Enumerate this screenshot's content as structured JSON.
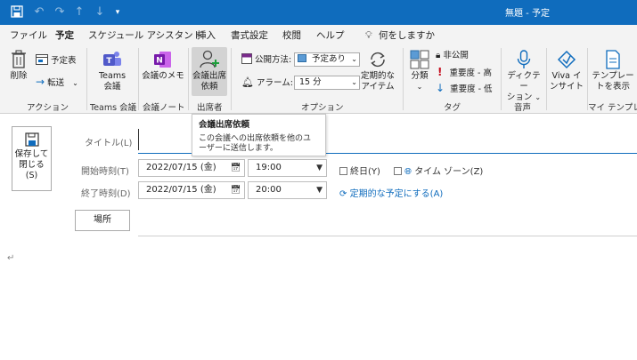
{
  "titlebar": {
    "window_title": "無題  -  予定",
    "icons": [
      "save-icon",
      "undo-icon",
      "redo-icon",
      "up-arrow-icon",
      "down-arrow-icon",
      "customize-icon"
    ]
  },
  "menu": {
    "tabs": [
      "ファイル",
      "予定",
      "スケジュール アシスタント",
      "挿入",
      "書式設定",
      "校閲",
      "ヘルプ"
    ],
    "active_tab": "予定",
    "search": "何をしますか"
  },
  "ribbon": {
    "action": {
      "delete": "削除",
      "calendar": "予定表",
      "forward": "転送",
      "group": "アクション"
    },
    "teams": {
      "button_line1": "Teams",
      "button_line2": "会議",
      "group": "Teams 会議"
    },
    "notes": {
      "button": "会議のメモ",
      "group": "会議ノート"
    },
    "attendees": {
      "button_line1": "会議出席",
      "button_line2": "依頼",
      "group": "出席者"
    },
    "options": {
      "show_as_label": "公開方法:",
      "show_as_value": "予定あり",
      "alarm_label": "アラーム:",
      "alarm_value": "15 分",
      "recurrence_line1": "定期的な",
      "recurrence_line2": "アイテム",
      "group": "オプション"
    },
    "tags": {
      "categorize": "分類",
      "private": "非公開",
      "high": "重要度 - 高",
      "low": "重要度 - 低",
      "group": "タグ"
    },
    "voice": {
      "dictate_line1": "ディクテー",
      "dictate_line2": "ション",
      "group": "音声"
    },
    "viva": {
      "line1": "Viva イ",
      "line2": "ンサイト"
    },
    "templates": {
      "line1": "テンプレー",
      "line2": "トを表示",
      "group": "マイ テンプレート"
    }
  },
  "tooltip": {
    "title": "会議出席依頼",
    "body": "この会議への出席依頼を他のユーザーに送信します。"
  },
  "form": {
    "save_close": {
      "line1": "保存して",
      "line2": "閉じる",
      "line3": "(S)"
    },
    "title_label": "タイトル(L)",
    "title_value": "",
    "start_label": "開始時刻(T)",
    "start_date": "2022/07/15 (金)",
    "start_time": "19:00",
    "allday_label": "終日(Y)",
    "timezone_label": "タイム ゾーン(Z)",
    "end_label": "終了時刻(D)",
    "end_date": "2022/07/15 (金)",
    "end_time": "20:00",
    "recurring_link": "定期的な予定にする(A)",
    "location_button": "場所"
  },
  "body_mark": "↵",
  "colors": {
    "accent": "#0f6cbd",
    "ribbon_bg": "#f3f3f3",
    "attendee_highlight": "#d3d3d3"
  }
}
